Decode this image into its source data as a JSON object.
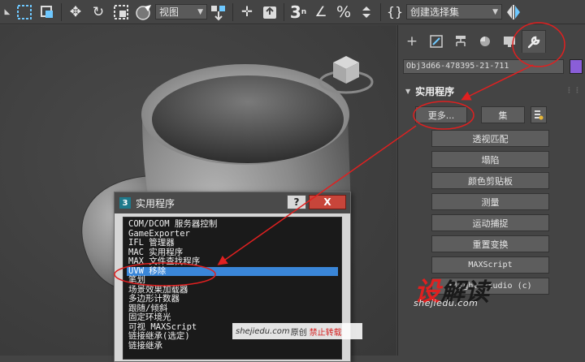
{
  "toolbar": {
    "view_dropdown": "视图",
    "selection_set_dropdown": "创建选择集",
    "snap_number": "3",
    "percent_symbol": "%",
    "braces_symbol": "{}"
  },
  "command_panel": {
    "tabs": [
      "create",
      "modify",
      "hierarchy",
      "motion",
      "display",
      "utilities"
    ],
    "active_tab": "utilities",
    "object_name": "Obj3d66-478395-21-711",
    "object_color": "#8a5ed8",
    "rollout_title": "实用程序",
    "more_button": "更多...",
    "sets_button": "集",
    "utilities": [
      "透视匹配",
      "塌陷",
      "颜色剪贴板",
      "测量",
      "运动捕捉",
      "重置变换",
      "MAXScript",
      "Flight Studio (c)"
    ]
  },
  "dialog": {
    "title": "实用程序",
    "help_button": "?",
    "close_button": "X",
    "items": [
      "COM/DCOM 服务器控制",
      "GameExporter",
      "IFL 管理器",
      "MAC 实用程序",
      "MAX 文件查找程序",
      "UVW 移除",
      "笔划",
      "场景效果加载器",
      "多边形计数器",
      "跟随/倾斜",
      "固定环境光",
      "可视 MAXScript",
      "链接继承(选定)",
      "链接继承"
    ],
    "selected_index": 5
  },
  "watermark": {
    "logo_red": "设",
    "logo_dark": "解读",
    "url": "shejiedu.com",
    "bar_url": "shejiedu.com",
    "bar_original": "原创",
    "bar_forbid": "禁止转载"
  },
  "colors": {
    "accent_selection": "#3a86d8",
    "annotation_red": "#e02020",
    "close_button": "#c8453a"
  }
}
